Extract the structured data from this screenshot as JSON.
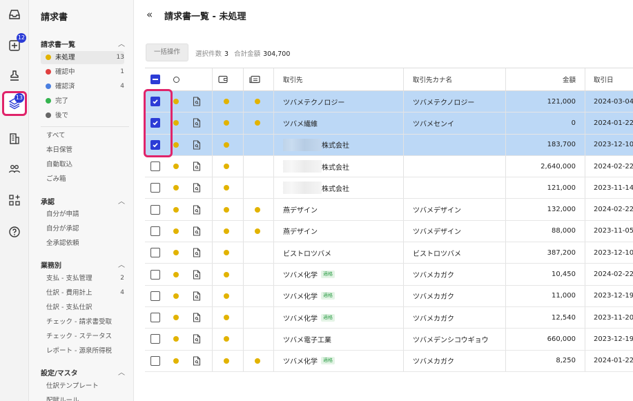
{
  "rail": {
    "items": [
      {
        "name": "inbox-icon",
        "badge": ""
      },
      {
        "name": "plus-box-icon",
        "badge": "12"
      },
      {
        "name": "stamp-icon",
        "badge": ""
      },
      {
        "name": "layers-icon",
        "badge": "13"
      },
      {
        "name": "building-icon",
        "badge": ""
      },
      {
        "name": "people-icon",
        "badge": ""
      },
      {
        "name": "apps-icon",
        "badge": ""
      },
      {
        "name": "help-icon",
        "badge": ""
      }
    ]
  },
  "sidebar": {
    "title": "請求書",
    "invoice_list": {
      "label": "請求書一覧",
      "items": [
        {
          "label": "未処理",
          "count": "13",
          "color": "#e2b300"
        },
        {
          "label": "確認中",
          "count": "1",
          "color": "#e04040"
        },
        {
          "label": "確認済",
          "count": "4",
          "color": "#4a7fe0"
        },
        {
          "label": "完了",
          "count": "",
          "color": "#34b44f"
        },
        {
          "label": "後で",
          "count": "",
          "color": "#666666"
        }
      ]
    },
    "misc_items": [
      "すべて",
      "本日保管",
      "自動取込",
      "ごみ箱"
    ],
    "approval": {
      "label": "承認",
      "items": [
        "自分が申請",
        "自分が承認",
        "全承認依頼"
      ]
    },
    "business": {
      "label": "業務別",
      "items": [
        {
          "label": "支払 - 支払管理",
          "count": "2"
        },
        {
          "label": "仕訳 - 費用計上",
          "count": "4"
        },
        {
          "label": "仕訳 - 支払仕訳",
          "count": ""
        },
        {
          "label": "チェック - 請求書受取",
          "count": ""
        },
        {
          "label": "チェック - ステータス",
          "count": ""
        },
        {
          "label": "レポート - 源泉所得税",
          "count": ""
        }
      ]
    },
    "settings": {
      "label": "設定/マスタ",
      "items": [
        "仕訳テンプレート",
        "配賦ルール"
      ]
    }
  },
  "main": {
    "title": "請求書一覧 - 未処理",
    "bulk_button": "一括操作",
    "summary": {
      "selected_label": "選択件数",
      "selected_value": "3",
      "total_label": "合計金額",
      "total_value": "304,700"
    }
  },
  "table": {
    "headers": {
      "vendor": "取引先",
      "kana": "取引先カナ名",
      "amount": "金額",
      "date": "取引日"
    },
    "tag_label": "適格",
    "rows": [
      {
        "checked": true,
        "d3": true,
        "vendor": "ツバメテクノロジー",
        "blur": false,
        "tag": false,
        "kana": "ツバメテクノロジー",
        "amount": "121,000",
        "date": "2024-03-04"
      },
      {
        "checked": true,
        "d3": true,
        "vendor": "ツバメ繊維",
        "blur": false,
        "tag": false,
        "kana": "ツバメセンイ",
        "amount": "0",
        "date": "2024-01-22"
      },
      {
        "checked": true,
        "d3": false,
        "vendor": "株式会社",
        "blur": true,
        "tag": false,
        "kana": "",
        "amount": "183,700",
        "date": "2023-12-10"
      },
      {
        "checked": false,
        "d3": false,
        "vendor": "株式会社",
        "blur": true,
        "tag": false,
        "kana": "",
        "amount": "2,640,000",
        "date": "2024-02-22"
      },
      {
        "checked": false,
        "d3": false,
        "vendor": "株式会社",
        "blur": true,
        "tag": false,
        "kana": "",
        "amount": "121,000",
        "date": "2023-11-14"
      },
      {
        "checked": false,
        "d3": true,
        "vendor": "燕デザイン",
        "blur": false,
        "tag": false,
        "kana": "ツバメデザイン",
        "amount": "132,000",
        "date": "2024-02-22"
      },
      {
        "checked": false,
        "d3": true,
        "vendor": "燕デザイン",
        "blur": false,
        "tag": false,
        "kana": "ツバメデザイン",
        "amount": "88,000",
        "date": "2023-11-05"
      },
      {
        "checked": false,
        "d3": false,
        "vendor": "ビストロツバメ",
        "blur": false,
        "tag": false,
        "kana": "ビストロツバメ",
        "amount": "387,200",
        "date": "2023-12-10"
      },
      {
        "checked": false,
        "d3": false,
        "vendor": "ツバメ化学",
        "blur": false,
        "tag": true,
        "kana": "ツバメカガク",
        "amount": "10,450",
        "date": "2024-02-22"
      },
      {
        "checked": false,
        "d3": false,
        "vendor": "ツバメ化学",
        "blur": false,
        "tag": true,
        "kana": "ツバメカガク",
        "amount": "11,000",
        "date": "2023-12-19"
      },
      {
        "checked": false,
        "d3": false,
        "vendor": "ツバメ化学",
        "blur": false,
        "tag": true,
        "kana": "ツバメカガク",
        "amount": "12,540",
        "date": "2023-11-20"
      },
      {
        "checked": false,
        "d3": false,
        "vendor": "ツバメ電子工業",
        "blur": false,
        "tag": false,
        "kana": "ツバメデンシコウギョウ",
        "amount": "660,000",
        "date": "2023-12-19"
      },
      {
        "checked": false,
        "d3": true,
        "vendor": "ツバメ化学",
        "blur": false,
        "tag": true,
        "kana": "ツバメカガク",
        "amount": "8,250",
        "date": "2024-01-22"
      }
    ]
  },
  "colors": {
    "accent": "#2c3cd6",
    "highlight": "#e0246a",
    "row_selected": "#bcd8f6",
    "status_dot": "#e2b300",
    "tag": "#2e9e48"
  }
}
